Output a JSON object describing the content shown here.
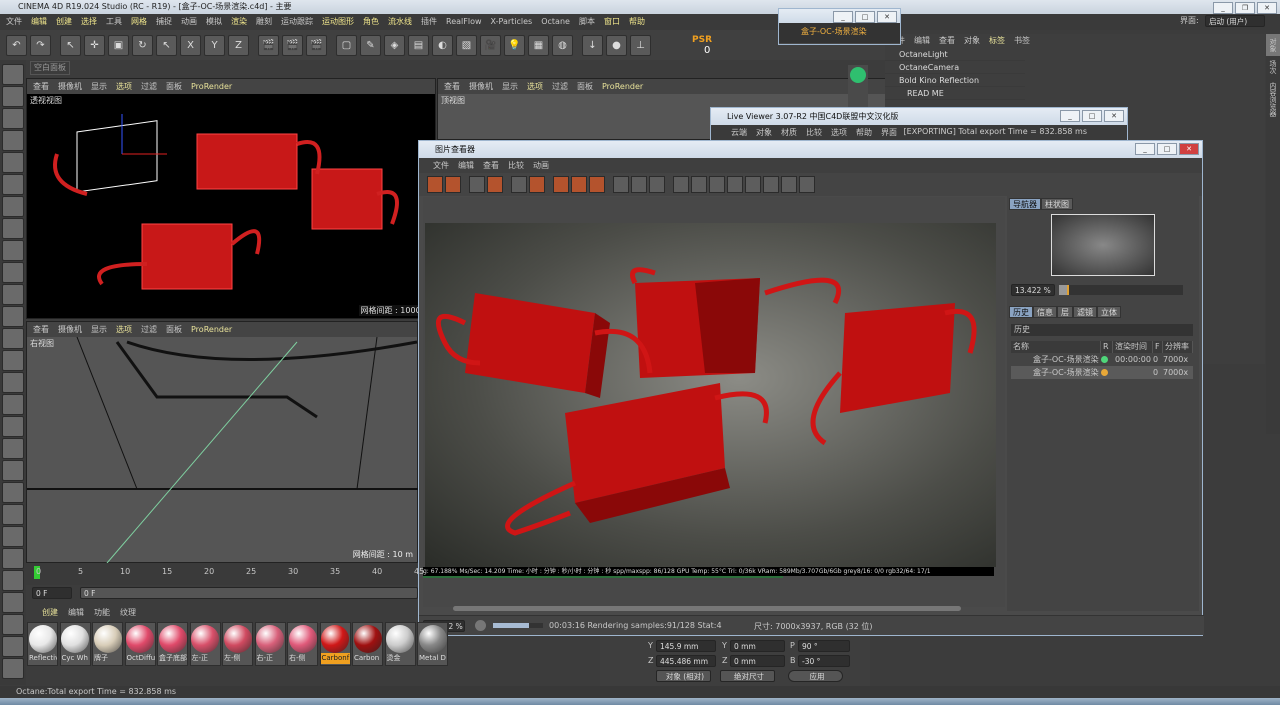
{
  "app": {
    "title": "CINEMA 4D R19.024 Studio (RC - R19) - [盒子-OC-场景渲染.c4d] - 主要"
  },
  "menu": [
    "文件",
    "编辑",
    "创建",
    "选择",
    "工具",
    "网格",
    "捕捉",
    "动画",
    "模拟",
    "渲染",
    "雕刻",
    "运动跟踪",
    "运动图形",
    "角色",
    "流水线",
    "插件",
    "RealFlow",
    "X-Particles",
    "Octane",
    "脚本",
    "窗口",
    "帮助"
  ],
  "layout": {
    "label": "界面:",
    "value": "启动 (用户)"
  },
  "toolbar": {
    "psr_label": "PSR",
    "psr_value": "0",
    "axis": "X Y Z"
  },
  "panel_tab": "空白面板",
  "viewport_menu": [
    "查看",
    "摄像机",
    "显示",
    "选项",
    "过滤",
    "面板",
    "ProRender"
  ],
  "viewports": {
    "perspective": {
      "label": "透视视图",
      "grid": "网格间距 : 1000 m"
    },
    "top": {
      "label": "顶视图"
    },
    "right": {
      "label": "右视图",
      "grid": "网格间距 : 10 m"
    }
  },
  "small_window": {
    "tab": "盒子-OC-场景渲染"
  },
  "object_manager": {
    "menu": [
      "文件",
      "编辑",
      "查看",
      "对象",
      "标签",
      "书签"
    ],
    "objects": [
      "OctaneLight",
      "OctaneCamera",
      "Bold Kino Reflection",
      "READ ME"
    ],
    "side_tabs": [
      "对象",
      "场次",
      "内容浏览器"
    ]
  },
  "live_viewer": {
    "title": "Live Viewer 3.07-R2 中国C4D联盟中文汉化版",
    "menu": [
      "云端",
      "对象",
      "材质",
      "比较",
      "选项",
      "帮助",
      "界面"
    ],
    "status": "[EXPORTING] Total export Time = 832.858 ms"
  },
  "picture_viewer": {
    "title": "图片查看器",
    "menu": [
      "文件",
      "编辑",
      "查看",
      "比较",
      "动画"
    ],
    "overlay": "g: 67.188% Ms/Sec: 14.209 Time: 小时 : 分钟 : 秒/小时 : 分钟 : 秒 spp/maxspp: 86/128 GPU Temp: 55°C Tri: 0/36k VRam: 589Mb/3.707Gb/6Gb grey8/16: 0/0 rgb32/64: 17/1",
    "zoom": "13.422 %",
    "progress": 0.711,
    "status": "00:03:16 Rendering samples:91/128 Stat:4",
    "size": "尺寸: 7000x3937, RGB (32 位)",
    "nav_tabs": [
      "导航器",
      "柱状图"
    ],
    "nav_zoom": "13.422 %",
    "history_tabs": [
      "历史",
      "信息",
      "层",
      "滤镜",
      "立体"
    ],
    "history_title": "历史",
    "history_columns": [
      "名称",
      "R",
      "渲染时间",
      "F",
      "分辨率"
    ],
    "history_rows": [
      {
        "name": "盒子-OC-场景渲染 *",
        "status_color": "#4fd67a",
        "time": "00:00:00",
        "f": "0",
        "res": "7000x"
      },
      {
        "name": "盒子-OC-场景渲染",
        "status_color": "#e8a838",
        "time": "",
        "f": "0",
        "res": "7000x"
      }
    ]
  },
  "timeline": {
    "ticks": [
      "0",
      "5",
      "10",
      "15",
      "20",
      "25",
      "30",
      "35",
      "40",
      "45"
    ],
    "frame": "0 F",
    "frame2": "0 F"
  },
  "materials": {
    "menu": [
      "创建",
      "编辑",
      "功能",
      "纹理"
    ],
    "items": [
      {
        "name": "Reflectiv",
        "color": "#e8e8e8"
      },
      {
        "name": "Cyc Wh",
        "color": "#e0e0e0"
      },
      {
        "name": "牌子",
        "color": "#d8cdb8"
      },
      {
        "name": "OctDiffu",
        "color": "#e04a6a"
      },
      {
        "name": "盒子底部",
        "color": "#e04a6a"
      },
      {
        "name": "左-正",
        "color": "#d8506a"
      },
      {
        "name": "左-侧",
        "color": "#d04a60"
      },
      {
        "name": "右-正",
        "color": "#d8607a"
      },
      {
        "name": "右-侧",
        "color": "#e05a7a"
      },
      {
        "name": "Carbonf",
        "color": "#d01818",
        "selected": true
      },
      {
        "name": "Carbon",
        "color": "#a01010"
      },
      {
        "name": "烫金",
        "color": "#cccccc"
      },
      {
        "name": "Metal D",
        "color": "#888888"
      }
    ]
  },
  "coords": {
    "y_pos": "145.9 mm",
    "z_pos": "445.486 mm",
    "y_size": "0 mm",
    "z_size": "0 mm",
    "p": "90 °",
    "b": "-30 °",
    "mode": "对象 (相对)",
    "size_mode": "绝对尺寸",
    "apply": "应用"
  },
  "statusbar": "Octane:Total export Time = 832.858 ms"
}
